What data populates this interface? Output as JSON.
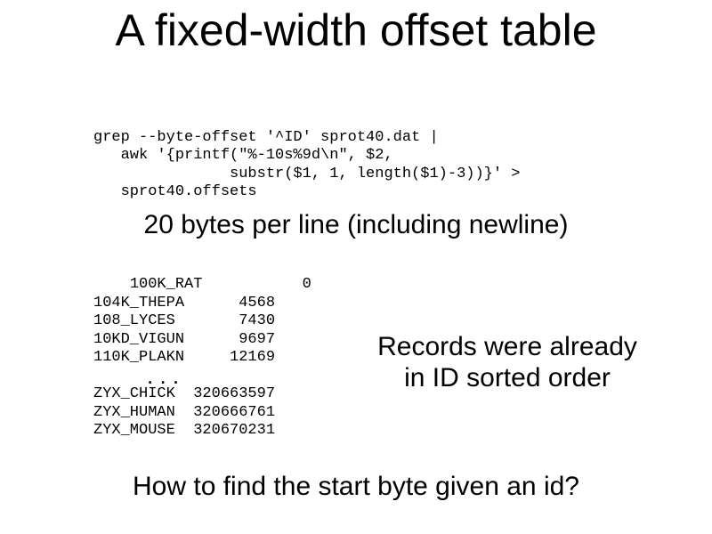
{
  "title": "A fixed-width offset table",
  "code": "grep --byte-offset '^ID' sprot40.dat |\n   awk '{printf(\"%-10s%9d\\n\", $2,\n               substr($1, 1, length($1)-3))}' >\n   sprot40.offsets",
  "subhead": "20 bytes per line (including newline)",
  "offsets_top": "100K_RAT           0\n104K_THEPA      4568\n108_LYCES       7430\n10KD_VIGUN      9697\n110K_PLAKN     12169",
  "ellipsis": ". . .",
  "offsets_bottom": "ZYX_CHICK  320663597\nZYX_HUMAN  320666761\nZYX_MOUSE  320670231",
  "note_line1": "Records were already",
  "note_line2": "in ID sorted order",
  "closing": "How to find the start byte given an id?"
}
